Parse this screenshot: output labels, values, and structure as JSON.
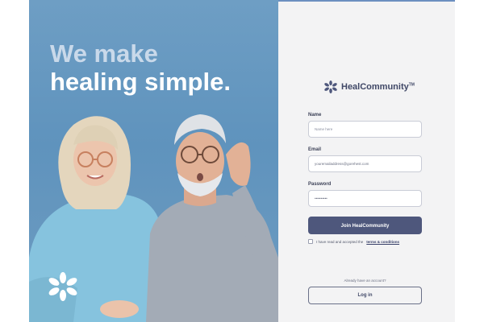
{
  "hero": {
    "headline_line1": "We make",
    "headline_line2": "healing simple."
  },
  "brand": {
    "name": "HealCommunity",
    "trademark": "TM"
  },
  "form": {
    "name_label": "Name",
    "name_placeholder": "Name here",
    "email_label": "Email",
    "email_value": "youremailaddress@gorehest.com",
    "password_label": "Password",
    "password_value": "••••••••••",
    "join_label": "Join HealCommunity",
    "terms_text": "I have read and accepted the",
    "terms_link": "terms & conditions",
    "already_text": "Already have an account?",
    "login_label": "Log in"
  },
  "colors": {
    "hero_bg": "#6496c0",
    "primary_button": "#4e577c",
    "panel_bg": "#f3f3f4",
    "accent_top": "#6c8fc0"
  }
}
